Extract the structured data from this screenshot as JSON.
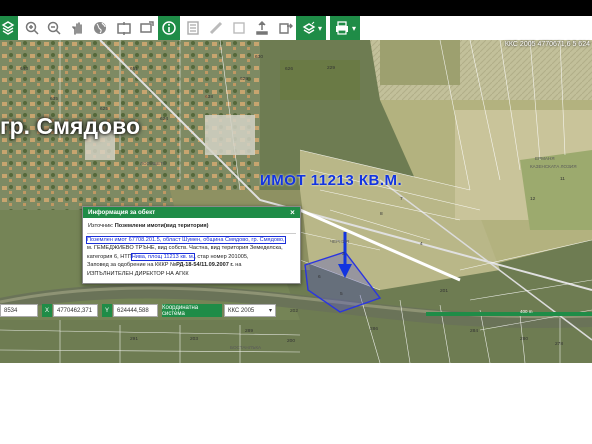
{
  "toolbar": {
    "buttons": [
      "layers-icon",
      "zoom-in-icon",
      "zoom-out-icon",
      "pan-icon",
      "globe-icon",
      "zoom-window-icon",
      "zoom-extent-icon",
      "info-icon",
      "legend-icon",
      "measure-icon",
      "draw-icon",
      "upload-icon",
      "export-icon",
      "layer-list-icon",
      "print-icon"
    ]
  },
  "map": {
    "crs_readout": "ККС 2005  4770671,6 5 624",
    "town_label": "гр. Смядово",
    "annotation": "ИМОТ 11213 КВ.М.",
    "place_labels": [
      "ЛОЗИЩЕТО",
      "ЕРМАНЯ",
      "КАЗЕНСКАТА ЛОЗИЯ",
      "ЧЕРНИЯ",
      "БОСТАНЛЪКА",
      "ГЕМЕДЖИЕВО"
    ],
    "parcel_numbers": [
      "229",
      "630",
      "638",
      "651",
      "624",
      "629",
      "626",
      "635",
      "643",
      "625",
      "634",
      "3",
      "6",
      "5",
      "201",
      "200",
      "202",
      "286",
      "280",
      "203",
      "278",
      "291",
      "289",
      "284",
      "8",
      "7",
      "4",
      "11",
      "12"
    ]
  },
  "popup": {
    "title": "Информация за обект",
    "source_label": "Източник:",
    "source_value": "Поземлени имоти(вид територия)",
    "lines": {
      "l1": "Поземлен имот 67708.201.5, област Шумен, община Смядово, гр. Смядово,",
      "l2": "м. ГЕМЕДЖИЕВО ТРЪНЕ, вид собств. Частна, вид територия Земеделска,",
      "l3a": "категория 6, НТП",
      "l3b": "Нива, площ 11213 кв. м.",
      "l3c": ", стар номер 201005,",
      "l4a": "Заповед за одобрение на КККР №",
      "l4b": "РД-18-54/11.09.2007 г.",
      "l4c": " на",
      "l5": "ИЗПЪЛНИТЕЛЕН ДИРЕКТОР НА АГКК"
    }
  },
  "coords": {
    "scale_value": "8534",
    "x_label": "X",
    "x_value": "4770462,371",
    "y_label": "Y",
    "y_value": "624444,588",
    "crs_label": "Координатна система",
    "crs_value": "ККС 2005"
  },
  "scale_bar": {
    "label": "400 m"
  }
}
